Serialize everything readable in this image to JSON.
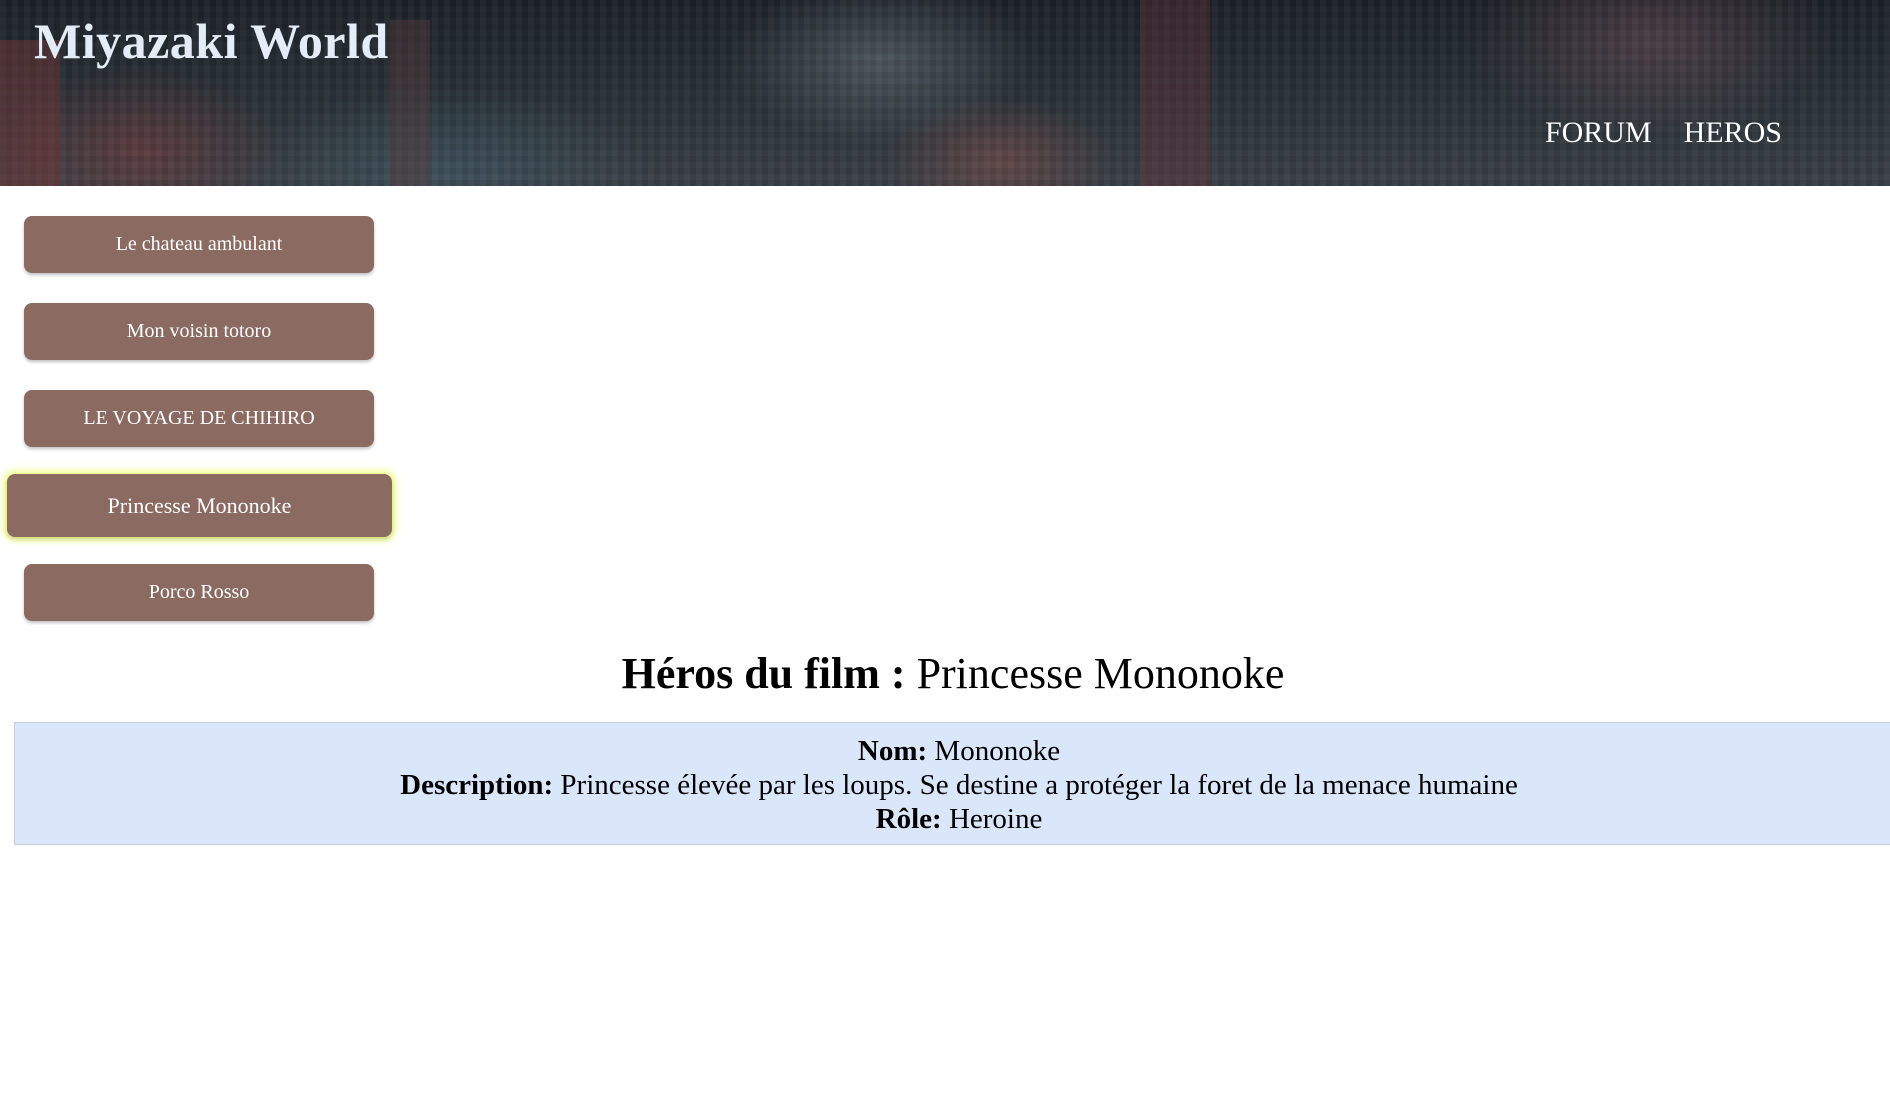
{
  "header": {
    "title": "Miyazaki World",
    "nav": [
      {
        "label": "FORUM"
      },
      {
        "label": "HEROS"
      }
    ]
  },
  "films": [
    {
      "label": "Le chateau ambulant",
      "active": false
    },
    {
      "label": "Mon voisin totoro",
      "active": false
    },
    {
      "label": "LE VOYAGE DE CHIHIRO",
      "active": false
    },
    {
      "label": "Princesse Mononoke",
      "active": true
    },
    {
      "label": "Porco Rosso",
      "active": false
    }
  ],
  "hero_section": {
    "heading_label": "Héros du film :",
    "film_name": "Princesse Mononoke",
    "fields": {
      "name_label": "Nom:",
      "name_value": "Mononoke",
      "description_label": "Description:",
      "description_value": "Princesse élevée par les loups. Se destine a protéger la foret de la menace humaine",
      "role_label": "Rôle:",
      "role_value": "Heroine"
    }
  },
  "colors": {
    "button_bg": "#8b6a62",
    "card_bg": "#dae6fa",
    "title_color": "#e4ecf8",
    "active_glow": "#e6ff3c"
  }
}
